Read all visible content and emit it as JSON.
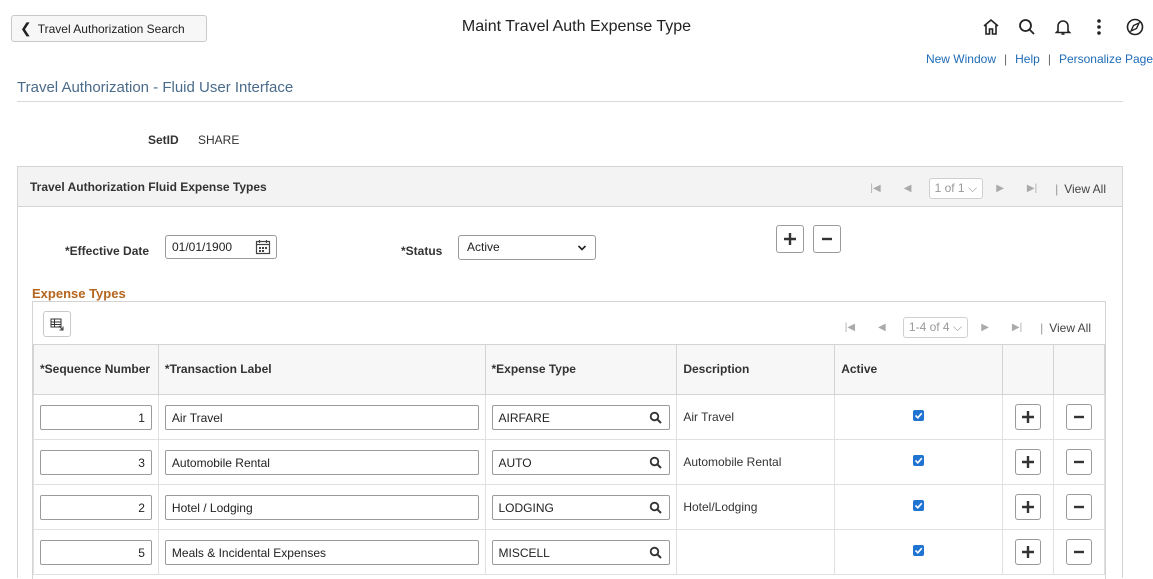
{
  "header": {
    "back_label": "Travel Authorization Search",
    "title": "Maint Travel Auth Expense Type",
    "icons": [
      "home-icon",
      "search-icon",
      "notification-bell-icon",
      "actions-menu-icon",
      "navbar-compass-icon"
    ]
  },
  "links": {
    "new_window": "New Window",
    "help": "Help",
    "personalize": "Personalize Page",
    "separator": "|"
  },
  "page_title": "Travel Authorization - Fluid User Interface",
  "setid": {
    "label": "SetID",
    "value": "SHARE"
  },
  "group": {
    "title": "Travel Authorization Fluid Expense Types",
    "pager": "1 of 1",
    "view_all": "View All",
    "effective_date_label": "*Effective Date",
    "effective_date": "01/01/1900",
    "status_label": "*Status",
    "status": "Active"
  },
  "expense_types": {
    "title": "Expense Types",
    "pager": "1-4 of 4",
    "view_all": "View All",
    "columns": {
      "sequence": "*Sequence Number",
      "label": "*Transaction Label",
      "type": "*Expense Type",
      "description": "Description",
      "active": "Active"
    },
    "rows": [
      {
        "sequence": "1",
        "label": "Air Travel",
        "type": "AIRFARE",
        "description": "Air Travel",
        "active": true
      },
      {
        "sequence": "3",
        "label": "Automobile Rental",
        "type": "AUTO",
        "description": "Automobile Rental",
        "active": true
      },
      {
        "sequence": "2",
        "label": "Hotel / Lodging",
        "type": "LODGING",
        "description": "Hotel/Lodging",
        "active": true
      },
      {
        "sequence": "5",
        "label": "Meals & Incidental Expenses",
        "type": "MISCELL",
        "description": "",
        "active": true
      }
    ]
  },
  "colors": {
    "link": "#1f6bb5",
    "section_title": "#b5651d",
    "page_title": "#4a6b8a",
    "checkbox": "#1f73d1"
  }
}
